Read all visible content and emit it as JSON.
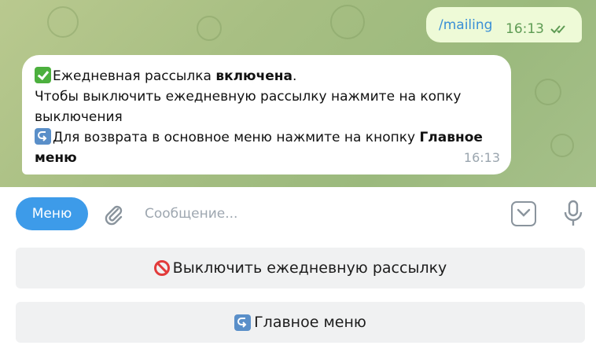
{
  "chat": {
    "outgoing": {
      "text": "/mailing",
      "time": "16:13",
      "status_icon": "double-check-read-icon"
    },
    "incoming": {
      "line1_emoji": "check-mark-button-emoji",
      "line1_prefix": "Ежедневная рассылка ",
      "line1_bold": "включена",
      "line1_suffix": ".",
      "line2": "Чтобы выключить ежедневную рассылку нажмите на копку",
      "line3": "выключения",
      "line4_emoji": "return-arrow-emoji",
      "line4_prefix": "Для возврата в основное меню нажмите на кнопку ",
      "line4_bold": "Главное",
      "line5_bold": "меню",
      "time": "16:13"
    }
  },
  "input_bar": {
    "menu_label": "Меню",
    "placeholder": "Сообщение...",
    "value": "",
    "attach_icon": "paperclip-icon",
    "keyboard_icon": "keyboard-toggle-icon",
    "mic_icon": "microphone-icon"
  },
  "keyboard": {
    "buttons": [
      {
        "emoji": "prohibited-emoji",
        "label": "Выключить ежедневную рассылку"
      },
      {
        "emoji": "return-arrow-emoji",
        "label": "Главное меню"
      }
    ]
  },
  "colors": {
    "accent": "#3d9be9",
    "outgoing_bubble": "#eefad7",
    "chat_background": "#a8bf83"
  }
}
